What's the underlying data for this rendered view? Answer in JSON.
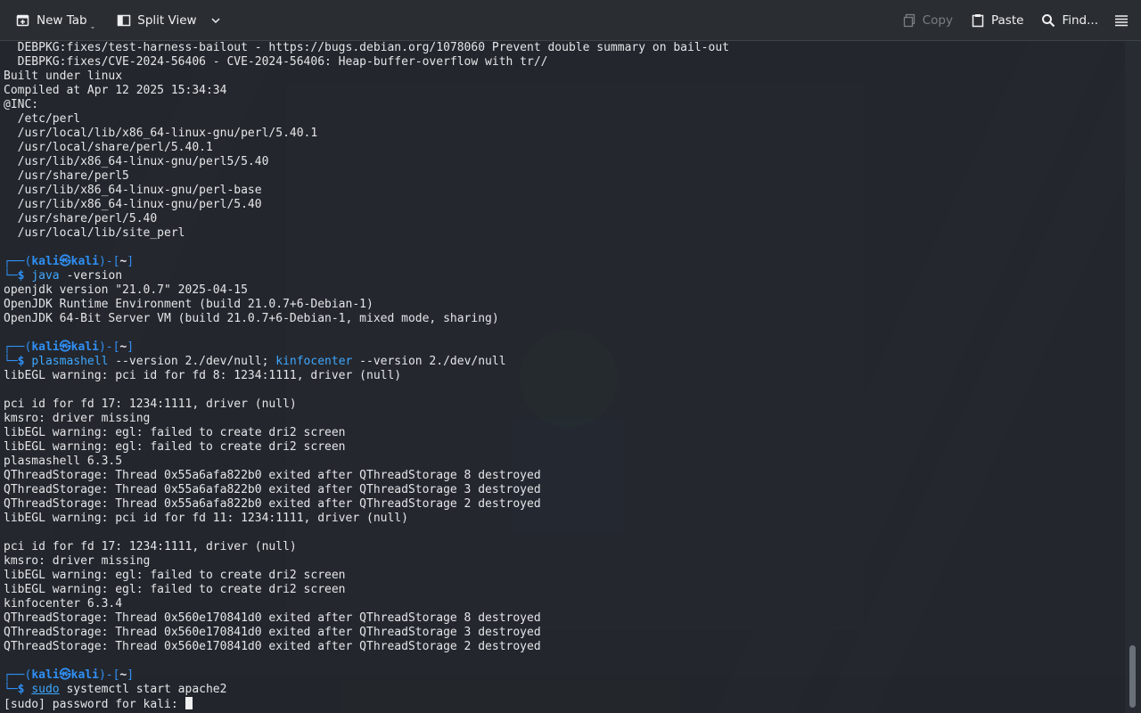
{
  "toolbar": {
    "new_tab": "New Tab",
    "split_view": "Split View",
    "copy": "Copy",
    "paste": "Paste",
    "find": "Find..."
  },
  "terminal": {
    "prompt": {
      "user": "kali",
      "host": "kali",
      "dir": "~"
    },
    "prelude": [
      "  DEBPKG:fixes/test-harness-bailout - https://bugs.debian.org/1078060 Prevent double summary on bail-out",
      "  DEBPKG:fixes/CVE-2024-56406 - CVE-2024-56406: Heap-buffer-overflow with tr//",
      "Built under linux",
      "Compiled at Apr 12 2025 15:34:34",
      "@INC:",
      "  /etc/perl",
      "  /usr/local/lib/x86_64-linux-gnu/perl/5.40.1",
      "  /usr/local/share/perl/5.40.1",
      "  /usr/lib/x86_64-linux-gnu/perl5/5.40",
      "  /usr/share/perl5",
      "  /usr/lib/x86_64-linux-gnu/perl-base",
      "  /usr/lib/x86_64-linux-gnu/perl/5.40",
      "  /usr/share/perl/5.40",
      "  /usr/local/lib/site_perl",
      ""
    ],
    "blocks": [
      {
        "cmd": "java",
        "args": " -version",
        "output": [
          "openjdk version \"21.0.7\" 2025-04-15",
          "OpenJDK Runtime Environment (build 21.0.7+6-Debian-1)",
          "OpenJDK 64-Bit Server VM (build 21.0.7+6-Debian-1, mixed mode, sharing)",
          ""
        ]
      },
      {
        "cmd": "plasmashell",
        "args": " --version 2./dev/null",
        "cmd2": "kinfocenter",
        "args2": " --version 2./dev/null",
        "output": [
          "libEGL warning: pci id for fd 8: 1234:1111, driver (null)",
          "",
          "pci id for fd 17: 1234:1111, driver (null)",
          "kmsro: driver missing",
          "libEGL warning: egl: failed to create dri2 screen",
          "libEGL warning: egl: failed to create dri2 screen",
          "plasmashell 6.3.5",
          "QThreadStorage: Thread 0x55a6afa822b0 exited after QThreadStorage 8 destroyed",
          "QThreadStorage: Thread 0x55a6afa822b0 exited after QThreadStorage 3 destroyed",
          "QThreadStorage: Thread 0x55a6afa822b0 exited after QThreadStorage 2 destroyed",
          "libEGL warning: pci id for fd 11: 1234:1111, driver (null)",
          "",
          "pci id for fd 17: 1234:1111, driver (null)",
          "kmsro: driver missing",
          "libEGL warning: egl: failed to create dri2 screen",
          "libEGL warning: egl: failed to create dri2 screen",
          "kinfocenter 6.3.4",
          "QThreadStorage: Thread 0x560e170841d0 exited after QThreadStorage 8 destroyed",
          "QThreadStorage: Thread 0x560e170841d0 exited after QThreadStorage 3 destroyed",
          "QThreadStorage: Thread 0x560e170841d0 exited after QThreadStorage 2 destroyed",
          ""
        ]
      },
      {
        "cmd": "sudo",
        "args": " systemctl start apache2",
        "output": []
      }
    ],
    "password_prompt": "[sudo] password for kali: "
  }
}
